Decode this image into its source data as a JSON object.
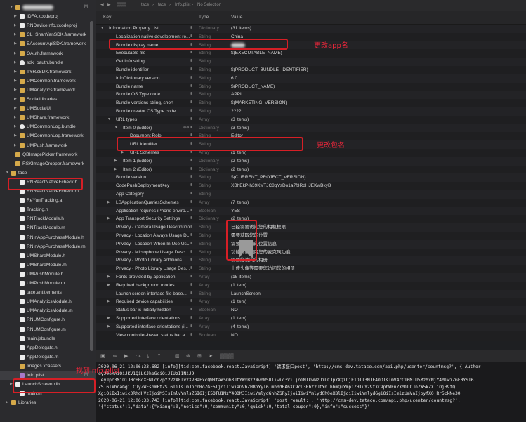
{
  "sidebar": {
    "items": [
      {
        "label": "",
        "badge": "M",
        "icon": "folder",
        "indent": 2,
        "arrow": "open",
        "blur": true
      },
      {
        "label": "IDFA.xcodeproj",
        "badge": "",
        "icon": "file",
        "indent": 3,
        "arrow": "closed"
      },
      {
        "label": "RNDeviceInfo.xcodeproj",
        "badge": "",
        "icon": "file",
        "indent": 3,
        "arrow": "closed"
      },
      {
        "label": "CL_ShanYanSDK.framework",
        "badge": "",
        "icon": "folder",
        "indent": 3,
        "arrow": "closed"
      },
      {
        "label": "EAccountApiSDK.framework",
        "badge": "",
        "icon": "folder",
        "indent": 3,
        "arrow": "closed"
      },
      {
        "label": "OAuth.framework",
        "badge": "",
        "icon": "folder",
        "indent": 3,
        "arrow": "closed"
      },
      {
        "label": "sdk_oauth.bundle",
        "badge": "",
        "icon": "shield",
        "indent": 3,
        "arrow": "closed"
      },
      {
        "label": "TYRZSDK.framework",
        "badge": "",
        "icon": "folder",
        "indent": 3,
        "arrow": "closed"
      },
      {
        "label": "UMCommon.framework",
        "badge": "",
        "icon": "folder",
        "indent": 3,
        "arrow": "closed"
      },
      {
        "label": "UMAnalytics.framework",
        "badge": "",
        "icon": "folder",
        "indent": 3,
        "arrow": "closed"
      },
      {
        "label": "SocialLibraries",
        "badge": "",
        "icon": "folder",
        "indent": 3,
        "arrow": "closed"
      },
      {
        "label": "UMSocialUI",
        "badge": "",
        "icon": "folder",
        "indent": 3,
        "arrow": "closed"
      },
      {
        "label": "UMShare.framework",
        "badge": "",
        "icon": "folder",
        "indent": 3,
        "arrow": "closed"
      },
      {
        "label": "UMCommonLog.bundle",
        "badge": "",
        "icon": "shield",
        "indent": 3,
        "arrow": "closed"
      },
      {
        "label": "UMCommonLog.framework",
        "badge": "",
        "icon": "folder",
        "indent": 3,
        "arrow": "closed"
      },
      {
        "label": "UMPush.framework",
        "badge": "",
        "icon": "folder",
        "indent": 3,
        "arrow": "closed"
      },
      {
        "label": "QBImagePicker.framework",
        "badge": "",
        "icon": "folder",
        "indent": 2,
        "arrow": ""
      },
      {
        "label": "RSKImageCropper.framework",
        "badge": "",
        "icon": "folder",
        "indent": 2,
        "arrow": ""
      },
      {
        "label": "tace",
        "badge": "",
        "icon": "folder",
        "indent": 1,
        "arrow": "open"
      },
      {
        "label": "RNReactNativeFcheck.h",
        "badge": "",
        "icon": "file",
        "indent": 3,
        "arrow": ""
      },
      {
        "label": "RNReactNativeFcheck.m",
        "badge": "",
        "icon": "file",
        "indent": 3,
        "arrow": ""
      },
      {
        "label": "ReYunTracking.a",
        "badge": "",
        "icon": "file",
        "indent": 3,
        "arrow": ""
      },
      {
        "label": "Tracking.h",
        "badge": "",
        "icon": "file",
        "indent": 3,
        "arrow": ""
      },
      {
        "label": "RNTrackModule.h",
        "badge": "",
        "icon": "file",
        "indent": 3,
        "arrow": ""
      },
      {
        "label": "RNTrackModule.m",
        "badge": "",
        "icon": "file",
        "indent": 3,
        "arrow": ""
      },
      {
        "label": "RNInAppPurchaseModule.h",
        "badge": "",
        "icon": "file",
        "indent": 3,
        "arrow": ""
      },
      {
        "label": "RNInAppPurchaseModule.m",
        "badge": "",
        "icon": "file",
        "indent": 3,
        "arrow": ""
      },
      {
        "label": "UMShareModule.h",
        "badge": "",
        "icon": "file",
        "indent": 3,
        "arrow": ""
      },
      {
        "label": "UMShareModule.m",
        "badge": "",
        "icon": "file",
        "indent": 3,
        "arrow": ""
      },
      {
        "label": "UMPushModule.h",
        "badge": "",
        "icon": "file",
        "indent": 3,
        "arrow": ""
      },
      {
        "label": "UMPushModule.m",
        "badge": "",
        "icon": "file",
        "indent": 3,
        "arrow": ""
      },
      {
        "label": "tace.entitlements",
        "badge": "",
        "icon": "file",
        "indent": 3,
        "arrow": ""
      },
      {
        "label": "UMAnalyticsModule.h",
        "badge": "",
        "icon": "file",
        "indent": 3,
        "arrow": ""
      },
      {
        "label": "UMAnalyticsModule.m",
        "badge": "",
        "icon": "file",
        "indent": 3,
        "arrow": ""
      },
      {
        "label": "RNUMConfigure.h",
        "badge": "",
        "icon": "file",
        "indent": 3,
        "arrow": ""
      },
      {
        "label": "RNUMConfigure.m",
        "badge": "",
        "icon": "file",
        "indent": 3,
        "arrow": ""
      },
      {
        "label": "main.jsbundle",
        "badge": "",
        "icon": "file",
        "indent": 3,
        "arrow": ""
      },
      {
        "label": "AppDelegate.h",
        "badge": "",
        "icon": "file",
        "indent": 3,
        "arrow": ""
      },
      {
        "label": "AppDelegate.m",
        "badge": "",
        "icon": "file",
        "indent": 3,
        "arrow": ""
      },
      {
        "label": "Images.xcassets",
        "badge": "",
        "icon": "folder",
        "indent": 3,
        "arrow": ""
      },
      {
        "label": "Info.plist",
        "badge": "M",
        "icon": "plist",
        "indent": 3,
        "arrow": "",
        "selected": true
      },
      {
        "label": "LaunchScreen.xib",
        "badge": "",
        "icon": "file",
        "indent": 2,
        "arrow": "closed"
      },
      {
        "label": "main.m",
        "badge": "",
        "icon": "file",
        "indent": 3,
        "arrow": ""
      },
      {
        "label": "Libraries",
        "badge": "",
        "icon": "folder",
        "indent": 1,
        "arrow": "closed"
      }
    ]
  },
  "toolbar": {
    "crumbs": [
      "tace",
      "tace",
      "Info.plist",
      "No Selection"
    ]
  },
  "table": {
    "headers": {
      "key": "Key",
      "type": "Type",
      "value": "Value"
    },
    "rows": [
      {
        "key": "Information Property List",
        "type": "Dictionary",
        "value": "(31 items)",
        "level": 0,
        "arrow": "open"
      },
      {
        "key": "Localization native development re...",
        "type": "String",
        "value": "China",
        "level": 1
      },
      {
        "key": "Bundle display name",
        "type": "String",
        "value": "",
        "level": 1,
        "blur": true
      },
      {
        "key": "Executable file",
        "type": "String",
        "value": "$(EXECUTABLE_NAME)",
        "level": 1
      },
      {
        "key": "Get Info string",
        "type": "String",
        "value": "",
        "level": 1
      },
      {
        "key": "Bundle identifier",
        "type": "String",
        "value": "$(PRODUCT_BUNDLE_IDENTIFIER)",
        "level": 1
      },
      {
        "key": "InfoDictionary version",
        "type": "String",
        "value": "6.0",
        "level": 1
      },
      {
        "key": "Bundle name",
        "type": "String",
        "value": "$(PRODUCT_NAME)",
        "level": 1
      },
      {
        "key": "Bundle OS Type code",
        "type": "String",
        "value": "APPL",
        "level": 1
      },
      {
        "key": "Bundle versions string, short",
        "type": "String",
        "value": "$(MARKETING_VERSION)",
        "level": 1
      },
      {
        "key": "Bundle creator OS Type code",
        "type": "String",
        "value": "????",
        "level": 1
      },
      {
        "key": "URL types",
        "type": "Array",
        "value": "(3 items)",
        "level": 1,
        "arrow": "open"
      },
      {
        "key": "Item 0 (Editor)",
        "type": "Dictionary",
        "value": "(3 items)",
        "level": 2,
        "arrow": "open",
        "editing": true
      },
      {
        "key": "Document Role",
        "type": "String",
        "value": "Editor",
        "level": 3
      },
      {
        "key": "URL identifier",
        "type": "String",
        "value": "",
        "level": 3
      },
      {
        "key": "URL Schemes",
        "type": "Array",
        "value": "(1 item)",
        "level": 3,
        "arrow": "closed"
      },
      {
        "key": "Item 1 (Editor)",
        "type": "Dictionary",
        "value": "(2 items)",
        "level": 2,
        "arrow": "closed"
      },
      {
        "key": "Item 2 (Editor)",
        "type": "Dictionary",
        "value": "(2 items)",
        "level": 2,
        "arrow": "closed"
      },
      {
        "key": "Bundle version",
        "type": "String",
        "value": "$(CURRENT_PROJECT_VERSION)",
        "level": 1
      },
      {
        "key": "CodePushDeploymentKey",
        "type": "String",
        "value": "XBhEkP-h39KwTJC8qYsDo1a7f3RdHJEKwBkyB",
        "level": 1
      },
      {
        "key": "App Category",
        "type": "String",
        "value": "",
        "level": 1
      },
      {
        "key": "LSApplicationQueriesSchemes",
        "type": "Array",
        "value": "(7 items)",
        "level": 1,
        "arrow": "closed"
      },
      {
        "key": "Application requires iPhone enviro...",
        "type": "Boolean",
        "value": "YES",
        "level": 1
      },
      {
        "key": "App Transport Security Settings",
        "type": "Dictionary",
        "value": "(2 items)",
        "level": 1,
        "arrow": "closed"
      },
      {
        "key": "Privacy - Camera Usage Description",
        "type": "String",
        "value": "已经需要访问您的相机权限",
        "level": 1
      },
      {
        "key": "Privacy - Location Always Usage D...",
        "type": "String",
        "value": "需要获取您的位置",
        "level": 1
      },
      {
        "key": "Privacy - Location When In Use Us...",
        "type": "String",
        "value": "需要获取您的位置信息",
        "level": 1
      },
      {
        "key": "Privacy - Microphone Usage Desc...",
        "type": "String",
        "value": "功能需要使用您的麦克风功能",
        "level": 1
      },
      {
        "key": "Privacy - Photo Library Additions...",
        "type": "String",
        "value": "需要您访问的相册",
        "level": 1
      },
      {
        "key": "Privacy - Photo Library Usage Des...",
        "type": "String",
        "value": "上传头像等需要您访问您的相册",
        "level": 1
      },
      {
        "key": "Fonts provided by application",
        "type": "Array",
        "value": "(15 items)",
        "level": 1,
        "arrow": "closed"
      },
      {
        "key": "Required background modes",
        "type": "Array",
        "value": "(1 item)",
        "level": 1,
        "arrow": "closed"
      },
      {
        "key": "Launch screen interface file base...",
        "type": "String",
        "value": "LaunchScreen",
        "level": 1
      },
      {
        "key": "Required device capabilities",
        "type": "Array",
        "value": "(1 item)",
        "level": 1,
        "arrow": "closed"
      },
      {
        "key": "Status bar is initially hidden",
        "type": "Boolean",
        "value": "NO",
        "level": 1
      },
      {
        "key": "Supported interface orientations",
        "type": "Array",
        "value": "(1 item)",
        "level": 1,
        "arrow": "closed"
      },
      {
        "key": "Supported interface orientations (i...",
        "type": "Array",
        "value": "(4 items)",
        "level": 1,
        "arrow": "closed"
      },
      {
        "key": "View controller-based status bar a...",
        "type": "Boolean",
        "value": "NO",
        "level": 1
      }
    ]
  },
  "console": {
    "lines": [
      "2020-06-21 12:06:33.682 [info][tid:com.facebook.react.JavaScript] '请求接口post', 'http://cms-dev.tatace.com/api.php/ucenter/countmsg?', { Author",
      "  eyJ0eXAiOiJKV1QiLCJhbGciOiJIUzI1NiJ9",
      "  .eyJpc3MiOiJ0cHBcXFNlcnZpY2VzXFlvYXV0aFxcQWRtaW5Ob3JtYWxBY2NvdW50Iiwic3ViIjoiMTkwNzUiLCJpYXQiOjE1OTI3MTE4ODIsImV4cCI6MTU5MzMxNjY4MiwiZGF0YSI6",
      "  ZSI6IkhoaGgiLCJyZWFsbmFtZSI6IiIsImJpcnRoZGF5IjoiIiwiaGVhZHBpYyI6Imh0dHA6XC9cL3RhY2UtYnJhbmQuYmp1ZHIuY29tXC9pbWFnZXMiLCJnZW5kZXIiOjB9fQ",
      "  XgiOiIxIiwic3RhdHVzIjoiMSIsImlvYmlsZSI6IjE5OTU1MzY4ODM3IiwiYmlydGhhZGRyIjoiIiwiYmlydGh0eXBlIjoiIiwiYmlydGgiOiIsImlzUmVnIjoyfX0.Rr5ckNe30",
      "2020-06-21 12:06:33.743 [info][tid:com.facebook.react.JavaScript] 'post result:', 'http://cms-dev.tatace.com/api.php/ucenter/countmsg?',",
      "  '{\"status\":1,\"data\":{\"xiang\":0,\"notice\":0,\"community\":0,\"quick\":0,\"total_coupon\":0},\"info\":\"success\"}'"
    ]
  },
  "annotations": {
    "app_name": "更改app名",
    "bundle_id": "更改包名",
    "find_plist": "找到info.plist"
  }
}
